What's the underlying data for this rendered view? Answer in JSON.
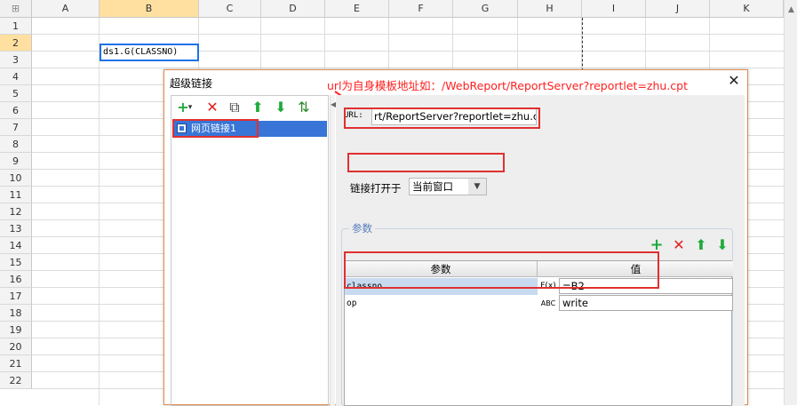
{
  "spreadsheet": {
    "corner_glyph": "⊞",
    "columns": [
      "A",
      "B",
      "C",
      "D",
      "E",
      "F",
      "G",
      "H",
      "I",
      "J",
      "K"
    ],
    "selected_column": "B",
    "rows": [
      "1",
      "2",
      "3",
      "4",
      "5",
      "6",
      "7",
      "8",
      "9",
      "10",
      "11",
      "12",
      "13",
      "14",
      "15",
      "16",
      "17",
      "18",
      "19",
      "20",
      "21",
      "22"
    ],
    "selected_row": "2",
    "cell_b2_value": "ds1.G(CLASSNO)"
  },
  "dialog": {
    "title": "超级链接",
    "close_glyph": "✕",
    "annotation": "url为自身模板地址如：/WebReport/ReportServer?reportlet=zhu.cpt",
    "left_toolbar": {
      "add": "+",
      "add_dropdown": "▾",
      "delete": "✕",
      "copy": "⧉",
      "up": "⬆",
      "down": "⬇",
      "sort": "⇅"
    },
    "link_list": [
      "网页链接1"
    ],
    "url_label": "URL:",
    "url_value": "rt/ReportServer?reportlet=zhu.cpt",
    "open_in_label": "链接打开于",
    "open_in_value": "当前窗口",
    "params_legend": "参数",
    "params_toolbar": {
      "add": "+",
      "delete": "✕",
      "up": "⬆",
      "down": "⬇"
    },
    "params_headers": {
      "name": "参数",
      "value": "值"
    },
    "params": [
      {
        "name": "classno",
        "type": "F(x)",
        "value": "=B2"
      },
      {
        "name": "op",
        "type": "ABC",
        "value": "write"
      }
    ]
  },
  "colors": {
    "accent_selection": "#3875d7",
    "annotation_red": "#ff2020",
    "add_green": "#1faa3c",
    "delete_red": "#e02020"
  }
}
